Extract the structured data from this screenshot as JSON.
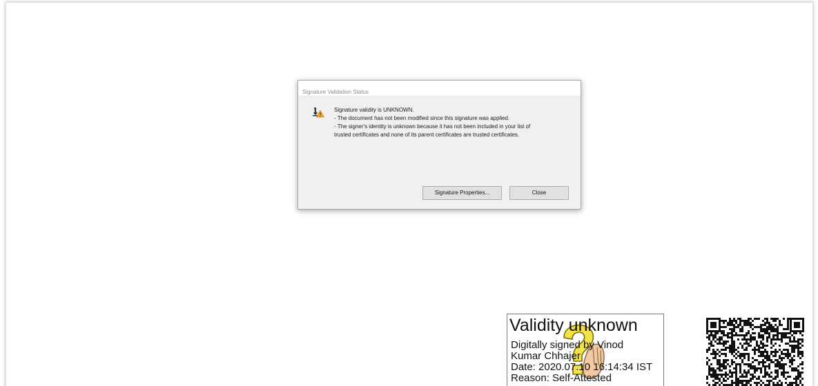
{
  "dialog": {
    "title": "Signature Validation Status",
    "icon": "warning-signature-icon",
    "messages": [
      "Signature validity is UNKNOWN.",
      "- The document has not been modified since this signature was applied.",
      "- The signer's identity is unknown because it has not been included in your list of",
      "trusted certificates and none of its parent certificates are trusted certificates."
    ],
    "buttons": {
      "properties": "Signature Properties...",
      "close": "Close"
    }
  },
  "signature_box": {
    "title": "Validity unknown",
    "lines": [
      "Digitally signed by Vinod",
      "Kumar Chhajer",
      "Date: 2020.07.10 16:14:34 IST",
      "Reason: Self-Attested"
    ],
    "icon": "question-mark-icon"
  },
  "qr_code": {
    "icon": "qr-code-icon"
  },
  "colors": {
    "dialog_bg": "#f0f0f0",
    "button_bg": "#e1e1e1",
    "warning": "#f5a623",
    "question_fill": "#f3e34a"
  }
}
